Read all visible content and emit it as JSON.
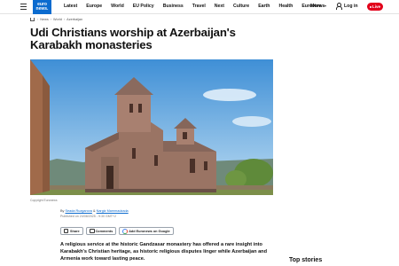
{
  "header": {
    "logo_line1": "euro",
    "logo_line2": "news.",
    "nav": [
      "Latest",
      "Europe",
      "World",
      "EU Policy",
      "Business",
      "Travel",
      "Next",
      "Culture",
      "Earth",
      "Health",
      "Euroviews"
    ],
    "more_label": "More",
    "login_label": "Log in",
    "live_label": "Live"
  },
  "breadcrumb": [
    "News",
    "World",
    "Azerbaijan"
  ],
  "article": {
    "headline": "Udi Christians worship at Azerbaijan's Karabakh monasteries",
    "copyright": "Copyright Euronews",
    "byline_prefix": "By",
    "author1": "Seada Ruzgarova",
    "byline_and": "&",
    "author2": "Nargiz Mammadzada",
    "published": "Published on 24/08/2025 - 9:30 GMT+2",
    "lead": "A religious service at the historic Gandzasar monastery has offered a rare insight into Karabakh's Christian heritage, as historic religious disputes linger while Azerbaijan and Armenia work toward lasting peace."
  },
  "actions": {
    "share": "Share",
    "comments": "Comments",
    "google": "Add Euronews on Google"
  },
  "sidebar": {
    "top_stories": "Top stories"
  },
  "colors": {
    "brand": "#0b6bcf",
    "live": "#e2001a"
  }
}
